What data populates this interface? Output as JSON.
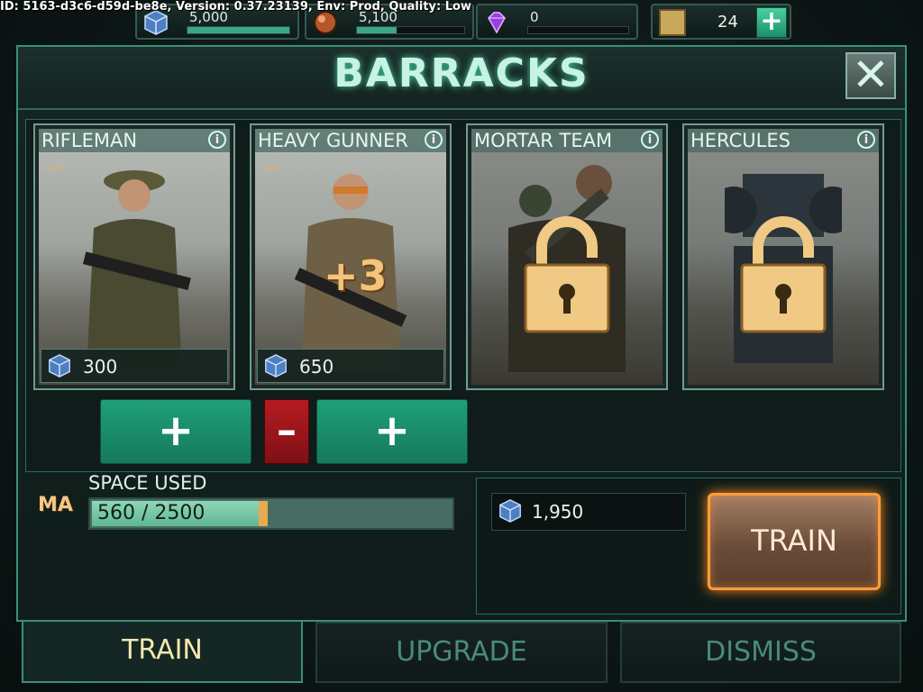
{
  "debug_text": "ID: 5163-d3c6-d59d-be8e, Version: 0.37.23139, Env: Prod, Quality: Low",
  "resources": [
    {
      "icon": "blue-cube-icon",
      "value": "5,000",
      "fill": 1.0
    },
    {
      "icon": "oil-orb-icon",
      "value": "5,100",
      "fill": 0.37
    },
    {
      "icon": "purple-gem-icon",
      "value": "0",
      "fill": 0.0
    }
  ],
  "medals": {
    "icon": "medal-icon",
    "value": "24",
    "plus_label": "+"
  },
  "panel": {
    "title": "BARRACKS",
    "close_label": "✕"
  },
  "units": [
    {
      "name": "RIFLEMAN",
      "cost": "300",
      "locked": false,
      "badge": ""
    },
    {
      "name": "HEAVY GUNNER",
      "cost": "650",
      "locked": false,
      "badge": "+3"
    },
    {
      "name": "MORTAR TEAM",
      "cost": "",
      "locked": true,
      "badge": ""
    },
    {
      "name": "HERCULES",
      "cost": "",
      "locked": true,
      "badge": ""
    }
  ],
  "controls": {
    "plus": "+",
    "minus": "–"
  },
  "space": {
    "label": "SPACE USED",
    "value_text": "560 / 2500",
    "used": 560,
    "max": 2500,
    "rank_icon": "MA"
  },
  "summary": {
    "total_cost": "1,950",
    "train_label": "TRAIN"
  },
  "tabs": [
    {
      "label": "TRAIN",
      "active": true
    },
    {
      "label": "UPGRADE",
      "active": false
    },
    {
      "label": "DISMISS",
      "active": false
    }
  ],
  "colors": {
    "accent": "#3b8f79",
    "train_glow": "#ff9d3c",
    "minus": "#b51c22",
    "plus": "#1f9f79"
  }
}
